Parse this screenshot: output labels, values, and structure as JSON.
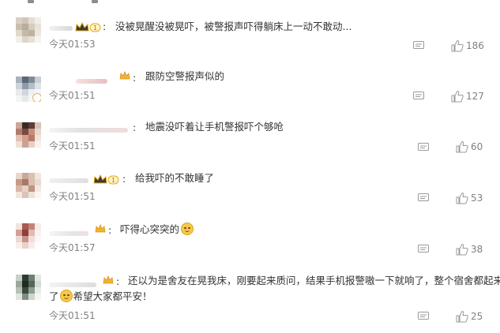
{
  "comments": [
    {
      "text": "没被晃醒没被晃吓，被警报声吓得躺床上一动不敢动...",
      "time": "今天01:53",
      "likes": "186",
      "vip_level": "1"
    },
    {
      "text": "跟防空警报声似的",
      "time": "今天01:51",
      "likes": "127"
    },
    {
      "text": "地震没吓着让手机警报吓个够呛",
      "time": "今天01:51",
      "likes": "60"
    },
    {
      "text": "给我吓的不敢睡了",
      "time": "今天01:51",
      "likes": "53",
      "vip_level": "1"
    },
    {
      "text": "吓得心突突的",
      "time": "今天01:57",
      "likes": "38"
    },
    {
      "text_line1": "还以为是舍友在晃我床，刚要起来质问，结果手机报警嗷一下就响了，整个宿舍都起来",
      "text_line2_prefix": "了",
      "text_line2": "希望大家都平安！",
      "time": "今天01:51",
      "likes": "25"
    }
  ],
  "colors": {
    "vip_gold": "#e6a817",
    "time_gray": "#808080",
    "icon_gray": "#9a9a9a",
    "text": "#333333"
  },
  "icons": {
    "reply": "comment-bubble-icon",
    "like": "thumbs-up-icon",
    "vip": "crown-badge-icon",
    "emoji": "emoji-icon"
  }
}
